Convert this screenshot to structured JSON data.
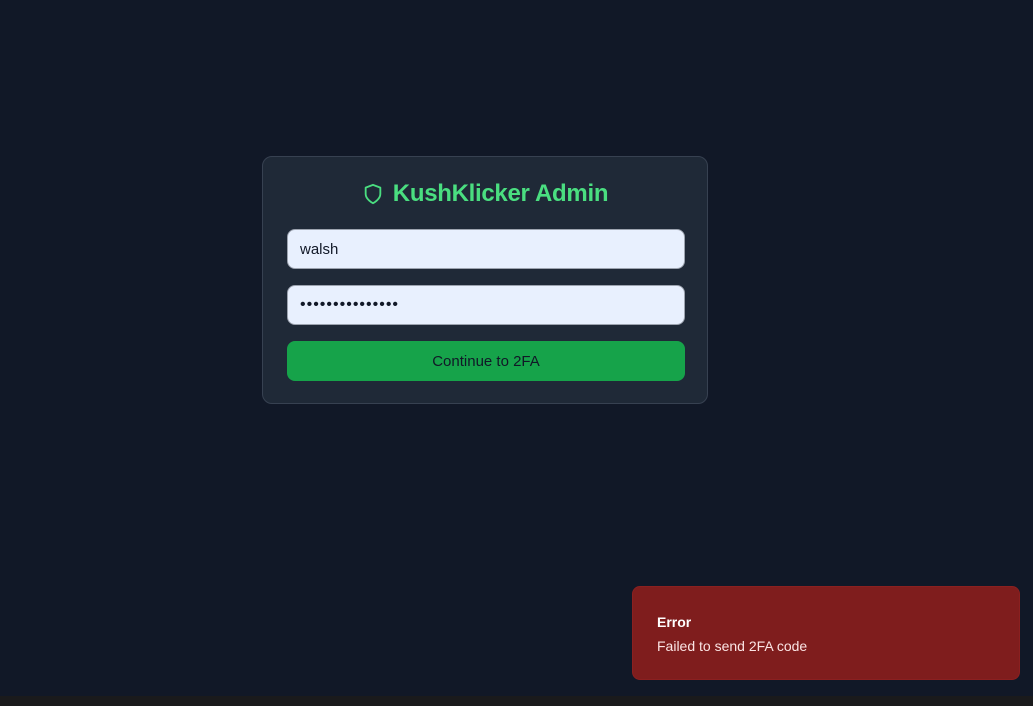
{
  "login": {
    "title": "KushKlicker Admin",
    "icon": "shield-icon",
    "accent_color": "#4ade80",
    "username_value": "walsh",
    "password_value": "•••••••••••••••",
    "submit_label": "Continue to 2FA",
    "submit_color": "#16a34a"
  },
  "toast": {
    "title": "Error",
    "message": "Failed to send 2FA code",
    "color": "#7f1d1d"
  }
}
